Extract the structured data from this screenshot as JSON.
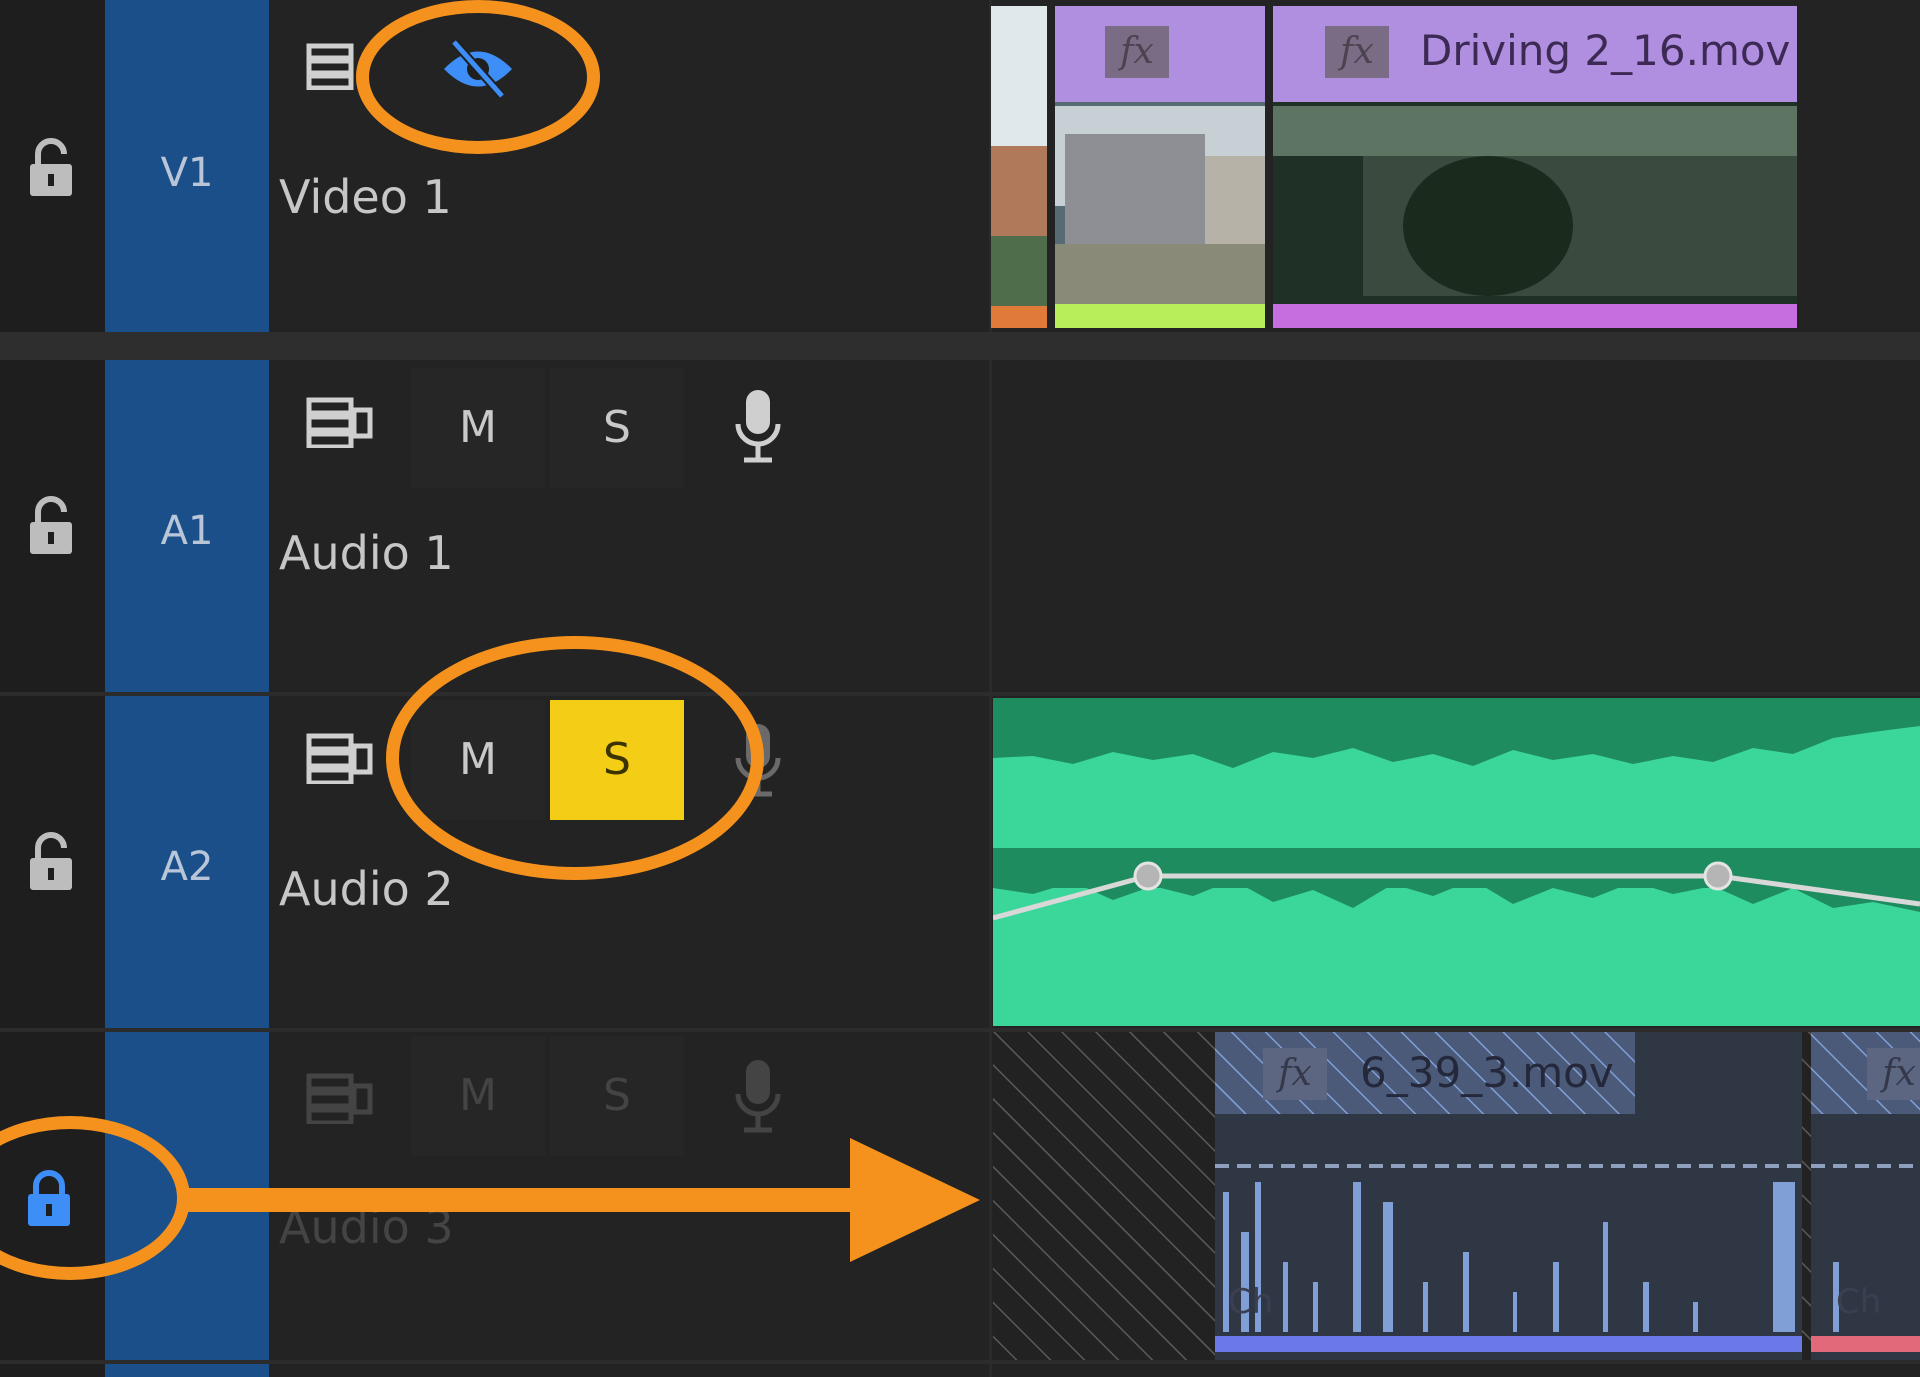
{
  "tracks": [
    {
      "tag": "V1",
      "name": "Video 1",
      "locked": false,
      "icons": [
        "track-options-icon",
        "eye-hidden-icon"
      ]
    },
    {
      "tag": "A1",
      "name": "Audio 1",
      "locked": false,
      "mute": "M",
      "solo": "S",
      "solo_active": false
    },
    {
      "tag": "A2",
      "name": "Audio 2",
      "locked": false,
      "mute": "M",
      "solo": "S",
      "solo_active": true
    },
    {
      "tag": "",
      "name": "Audio 3",
      "locked": true,
      "mute": "M",
      "solo": "S",
      "solo_active": false
    }
  ],
  "clips": {
    "video_clip_name": "Driving 2_16.mov",
    "audio3_clip_name": "6_39_3.mov",
    "fx_label": "fx",
    "ch_label": "Ch"
  },
  "colors": {
    "track_tag_blue": "#1b4f89",
    "video_clip_purple": "#b08ee0",
    "audio_waveform_green": "#3bd69a",
    "audio_clip_bg": "#1e8c5e",
    "solo_yellow": "#f4cd16",
    "lock_blue": "#3e8ef7",
    "annotation_orange": "#f5921e",
    "locked_clip_blue": "#7f9fd6"
  }
}
